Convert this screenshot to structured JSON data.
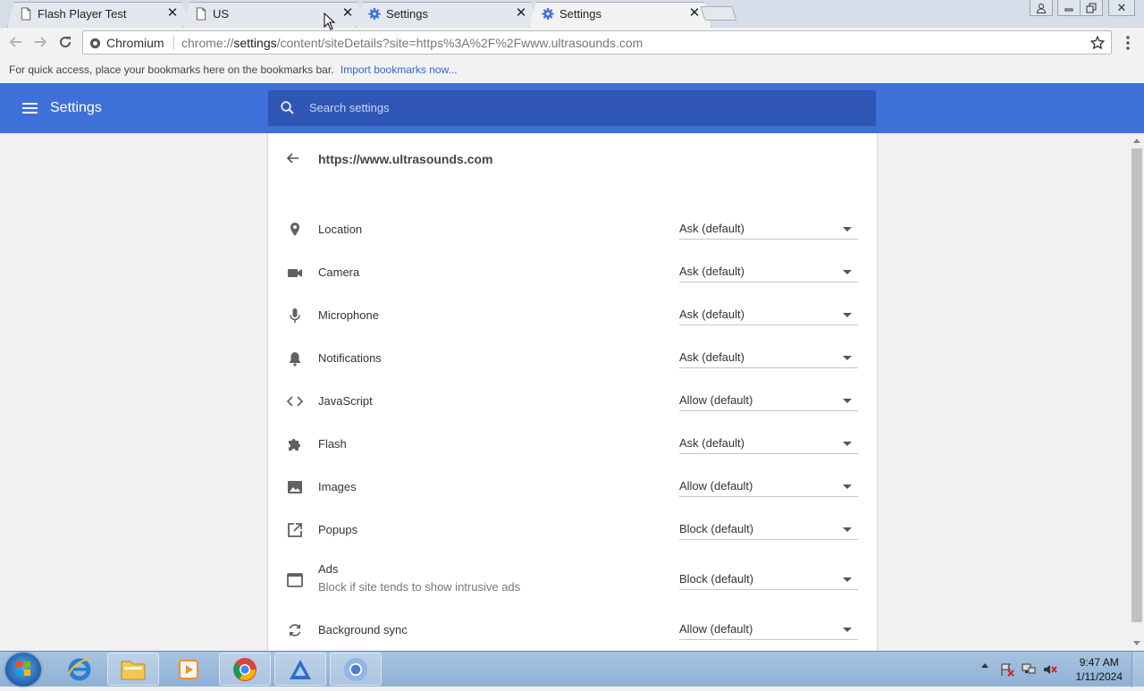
{
  "tabs": [
    {
      "label": "Flash Player Test",
      "icon": "page-icon",
      "active": false
    },
    {
      "label": "US",
      "icon": "page-icon",
      "active": false
    },
    {
      "label": "Settings",
      "icon": "gear-icon",
      "active": false
    },
    {
      "label": "Settings",
      "icon": "gear-icon",
      "active": true
    }
  ],
  "omnibox": {
    "site_name": "Chromium",
    "url_prefix": "chrome://",
    "url_host": "settings",
    "url_path": "/content/siteDetails?site=https%3A%2F%2Fwww.ultrasounds.com"
  },
  "bookmarks_bar": {
    "text": "For quick access, place your bookmarks here on the bookmarks bar.",
    "link": "Import bookmarks now..."
  },
  "header": {
    "title": "Settings",
    "search_placeholder": "Search settings"
  },
  "site_details": {
    "site": "https://www.ultrasounds.com",
    "permissions": [
      {
        "label": "Location",
        "value": "Ask (default)",
        "icon": "location-pin-icon"
      },
      {
        "label": "Camera",
        "value": "Ask (default)",
        "icon": "camera-icon"
      },
      {
        "label": "Microphone",
        "value": "Ask (default)",
        "icon": "microphone-icon"
      },
      {
        "label": "Notifications",
        "value": "Ask (default)",
        "icon": "bell-icon"
      },
      {
        "label": "JavaScript",
        "value": "Allow (default)",
        "icon": "code-icon"
      },
      {
        "label": "Flash",
        "value": "Ask (default)",
        "icon": "puzzle-icon"
      },
      {
        "label": "Images",
        "value": "Allow (default)",
        "icon": "image-icon"
      },
      {
        "label": "Popups",
        "value": "Block (default)",
        "icon": "open-in-new-icon"
      },
      {
        "label": "Ads",
        "sublabel": "Block if site tends to show intrusive ads",
        "value": "Block (default)",
        "icon": "ads-window-icon"
      },
      {
        "label": "Background sync",
        "value": "Allow (default)",
        "icon": "sync-icon"
      }
    ]
  },
  "taskbar": {
    "time": "9:47 AM",
    "date": "1/11/2024"
  },
  "colors": {
    "header_blue": "#3f6fd8",
    "search_blue": "#2f56b4",
    "link_blue": "#3367d6"
  }
}
